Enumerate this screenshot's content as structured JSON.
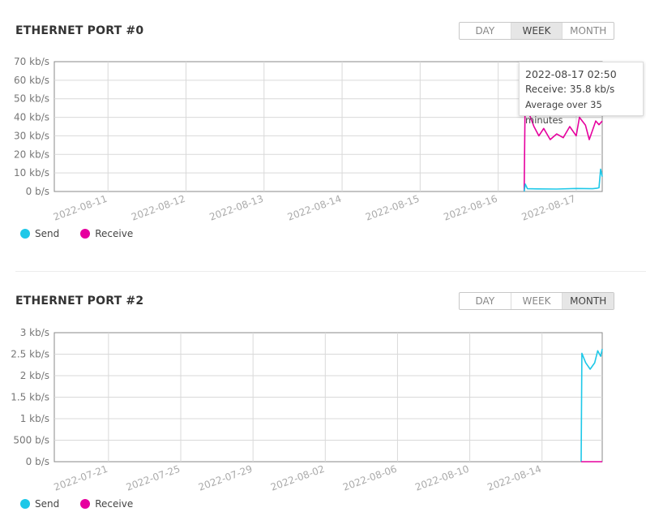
{
  "colors": {
    "send": "#1ec8e8",
    "receive": "#e6009e",
    "grid": "#d9d9d9",
    "axis": "#888888",
    "tick_text": "#777777"
  },
  "charts": [
    {
      "title": "ETHERNET PORT #0",
      "range_buttons": [
        {
          "label": "DAY",
          "active": false
        },
        {
          "label": "WEEK",
          "active": true
        },
        {
          "label": "MONTH",
          "active": false
        }
      ],
      "legend": [
        {
          "label": "Send",
          "series": "send"
        },
        {
          "label": "Receive",
          "series": "receive"
        }
      ],
      "tooltip": {
        "time": "2022-08-17 02:50",
        "value": "Receive: 35.8 kb/s",
        "note": "Average over 35 minutes"
      }
    },
    {
      "title": "ETHERNET PORT #2",
      "range_buttons": [
        {
          "label": "DAY",
          "active": false
        },
        {
          "label": "WEEK",
          "active": false
        },
        {
          "label": "MONTH",
          "active": true
        }
      ],
      "legend": [
        {
          "label": "Send",
          "series": "send"
        },
        {
          "label": "Receive",
          "series": "receive"
        }
      ]
    }
  ],
  "chart_data": [
    {
      "type": "line",
      "title": "",
      "xlabel": "",
      "ylabel": "",
      "ylim": [
        0,
        70
      ],
      "y_unit": "kb/s",
      "y_ticks": [
        "0 b/s",
        "10 kb/s",
        "20 kb/s",
        "30 kb/s",
        "40 kb/s",
        "50 kb/s",
        "60 kb/s",
        "70 kb/s"
      ],
      "x_ticks": [
        "2022-08-11",
        "2022-08-12",
        "2022-08-13",
        "2022-08-14",
        "2022-08-15",
        "2022-08-16",
        "2022-08-17"
      ],
      "xlim": [
        "2022-08-10 07:30",
        "2022-08-17 08:00"
      ],
      "grid": true,
      "legend_position": "bottom-left",
      "series": [
        {
          "name": "Send",
          "x": [
            "2022-08-16 08:00",
            "2022-08-16 08:20",
            "2022-08-16 09:00",
            "2022-08-16 12:00",
            "2022-08-16 18:00",
            "2022-08-17 00:00",
            "2022-08-17 05:00",
            "2022-08-17 06:30",
            "2022-08-17 07:00",
            "2022-08-17 07:30",
            "2022-08-17 08:00"
          ],
          "values": [
            0,
            4,
            1.5,
            1.4,
            1.3,
            1.6,
            1.5,
            1.8,
            2,
            12,
            8
          ]
        },
        {
          "name": "Receive",
          "x": [
            "2022-08-16 08:00",
            "2022-08-16 08:20",
            "2022-08-16 09:30",
            "2022-08-16 11:00",
            "2022-08-16 12:30",
            "2022-08-16 14:00",
            "2022-08-16 16:00",
            "2022-08-16 18:00",
            "2022-08-16 20:00",
            "2022-08-16 22:00",
            "2022-08-17 00:00",
            "2022-08-17 01:00",
            "2022-08-17 02:50",
            "2022-08-17 04:00",
            "2022-08-17 05:00",
            "2022-08-17 06:00",
            "2022-08-17 07:00",
            "2022-08-17 08:00"
          ],
          "values": [
            0,
            58,
            42,
            35,
            30,
            34,
            28,
            31,
            29,
            35,
            30,
            40,
            35.8,
            28,
            33,
            38,
            36,
            38
          ]
        }
      ]
    },
    {
      "type": "line",
      "title": "",
      "xlabel": "",
      "ylabel": "",
      "ylim": [
        0,
        3
      ],
      "y_unit": "kb/s",
      "y_ticks": [
        "0 b/s",
        "500 b/s",
        "1 kb/s",
        "1.5 kb/s",
        "2 kb/s",
        "2.5 kb/s",
        "3 kb/s"
      ],
      "x_ticks": [
        "2022-07-21",
        "2022-07-25",
        "2022-07-29",
        "2022-08-02",
        "2022-08-06",
        "2022-08-10",
        "2022-08-14"
      ],
      "xlim": [
        "2022-07-18 00:00",
        "2022-08-17 08:00"
      ],
      "grid": true,
      "legend_position": "bottom-left",
      "series": [
        {
          "name": "Send",
          "x": [
            "2022-08-16 04:00",
            "2022-08-16 05:00",
            "2022-08-16 10:00",
            "2022-08-16 16:00",
            "2022-08-16 22:00",
            "2022-08-17 02:00",
            "2022-08-17 06:00",
            "2022-08-17 08:00"
          ],
          "values": [
            0,
            2.52,
            2.3,
            2.15,
            2.3,
            2.58,
            2.45,
            2.62
          ]
        },
        {
          "name": "Receive",
          "x": [
            "2022-08-16 04:00",
            "2022-08-17 08:00"
          ],
          "values": [
            0,
            0
          ]
        }
      ]
    }
  ]
}
